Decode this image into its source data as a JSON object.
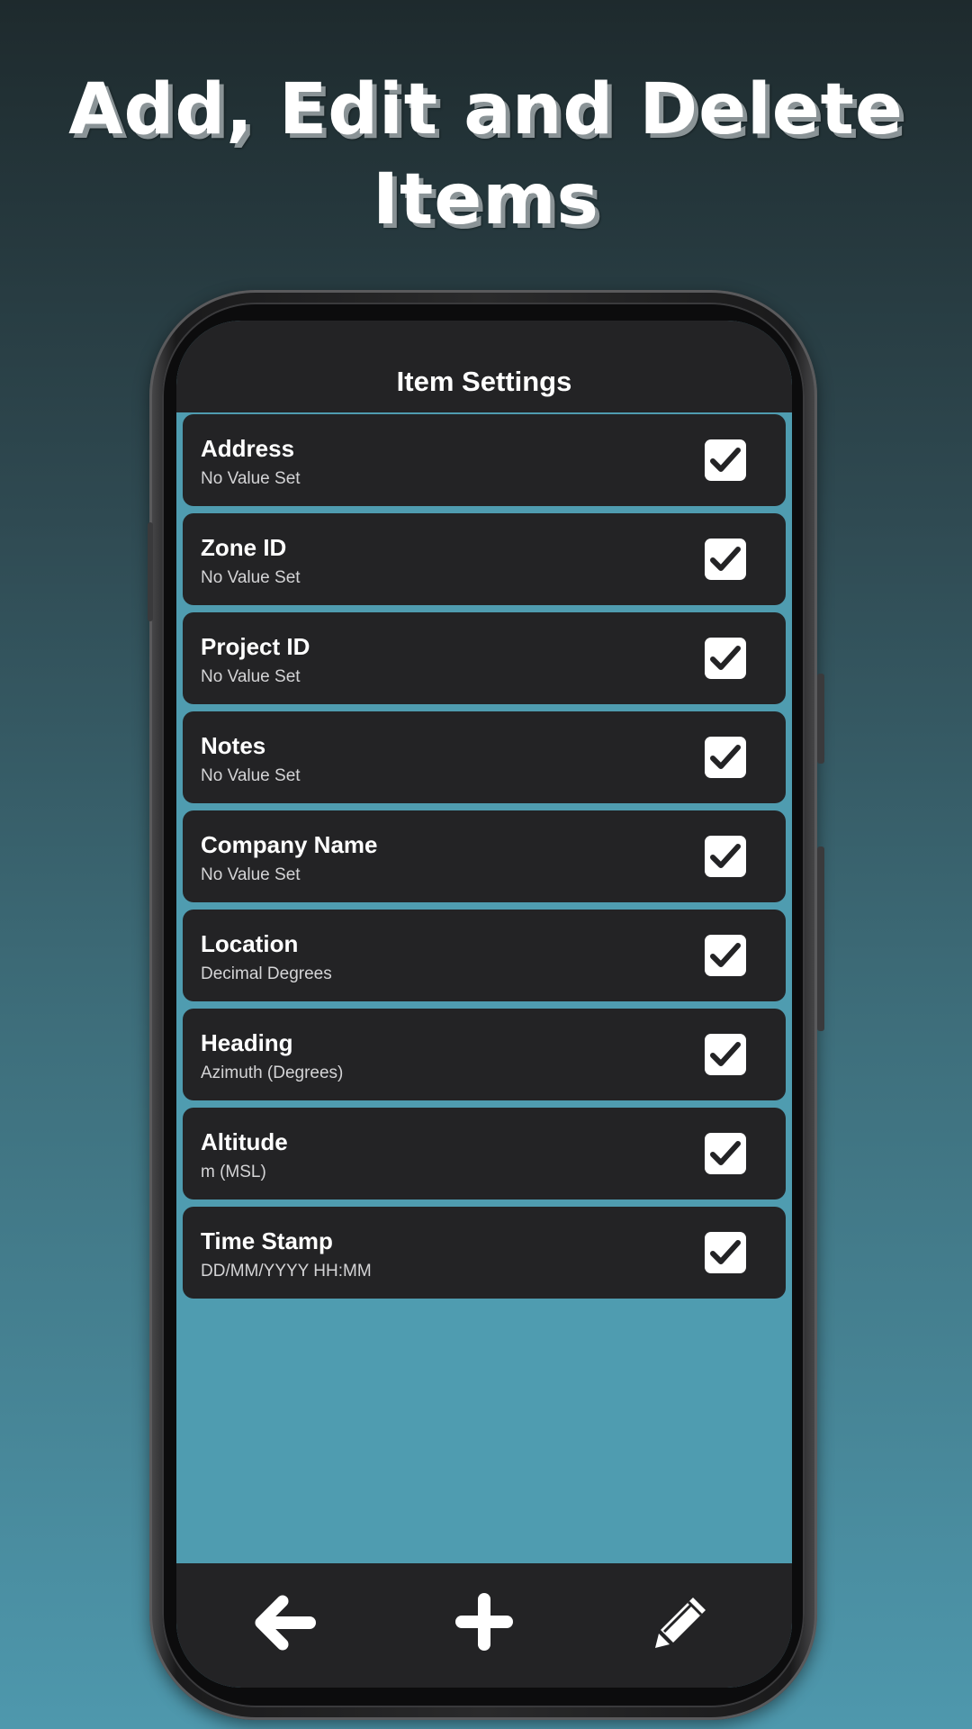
{
  "promo": {
    "headline_line1": "Add, Edit and Delete",
    "headline_line2": "Items"
  },
  "header": {
    "title": "Item Settings"
  },
  "items": [
    {
      "title": "Address",
      "subtitle": "No Value Set",
      "checked": true
    },
    {
      "title": "Zone ID",
      "subtitle": "No Value Set",
      "checked": true
    },
    {
      "title": "Project ID",
      "subtitle": "No Value Set",
      "checked": true
    },
    {
      "title": "Notes",
      "subtitle": "No Value Set",
      "checked": true
    },
    {
      "title": "Company Name",
      "subtitle": "No Value Set",
      "checked": true
    },
    {
      "title": "Location",
      "subtitle": "Decimal Degrees",
      "checked": true
    },
    {
      "title": "Heading",
      "subtitle": "Azimuth (Degrees)",
      "checked": true
    },
    {
      "title": "Altitude",
      "subtitle": "m (MSL)",
      "checked": true
    },
    {
      "title": "Time Stamp",
      "subtitle": "DD/MM/YYYY HH:MM",
      "checked": true
    }
  ],
  "bottom_nav": {
    "back_icon": "arrow-left-icon",
    "add_icon": "plus-icon",
    "edit_icon": "pencil-icon"
  },
  "colors": {
    "screen_background": "#4f9cb0",
    "panel": "#232325",
    "text": "#ffffff",
    "subtext": "#d4d4d6"
  }
}
